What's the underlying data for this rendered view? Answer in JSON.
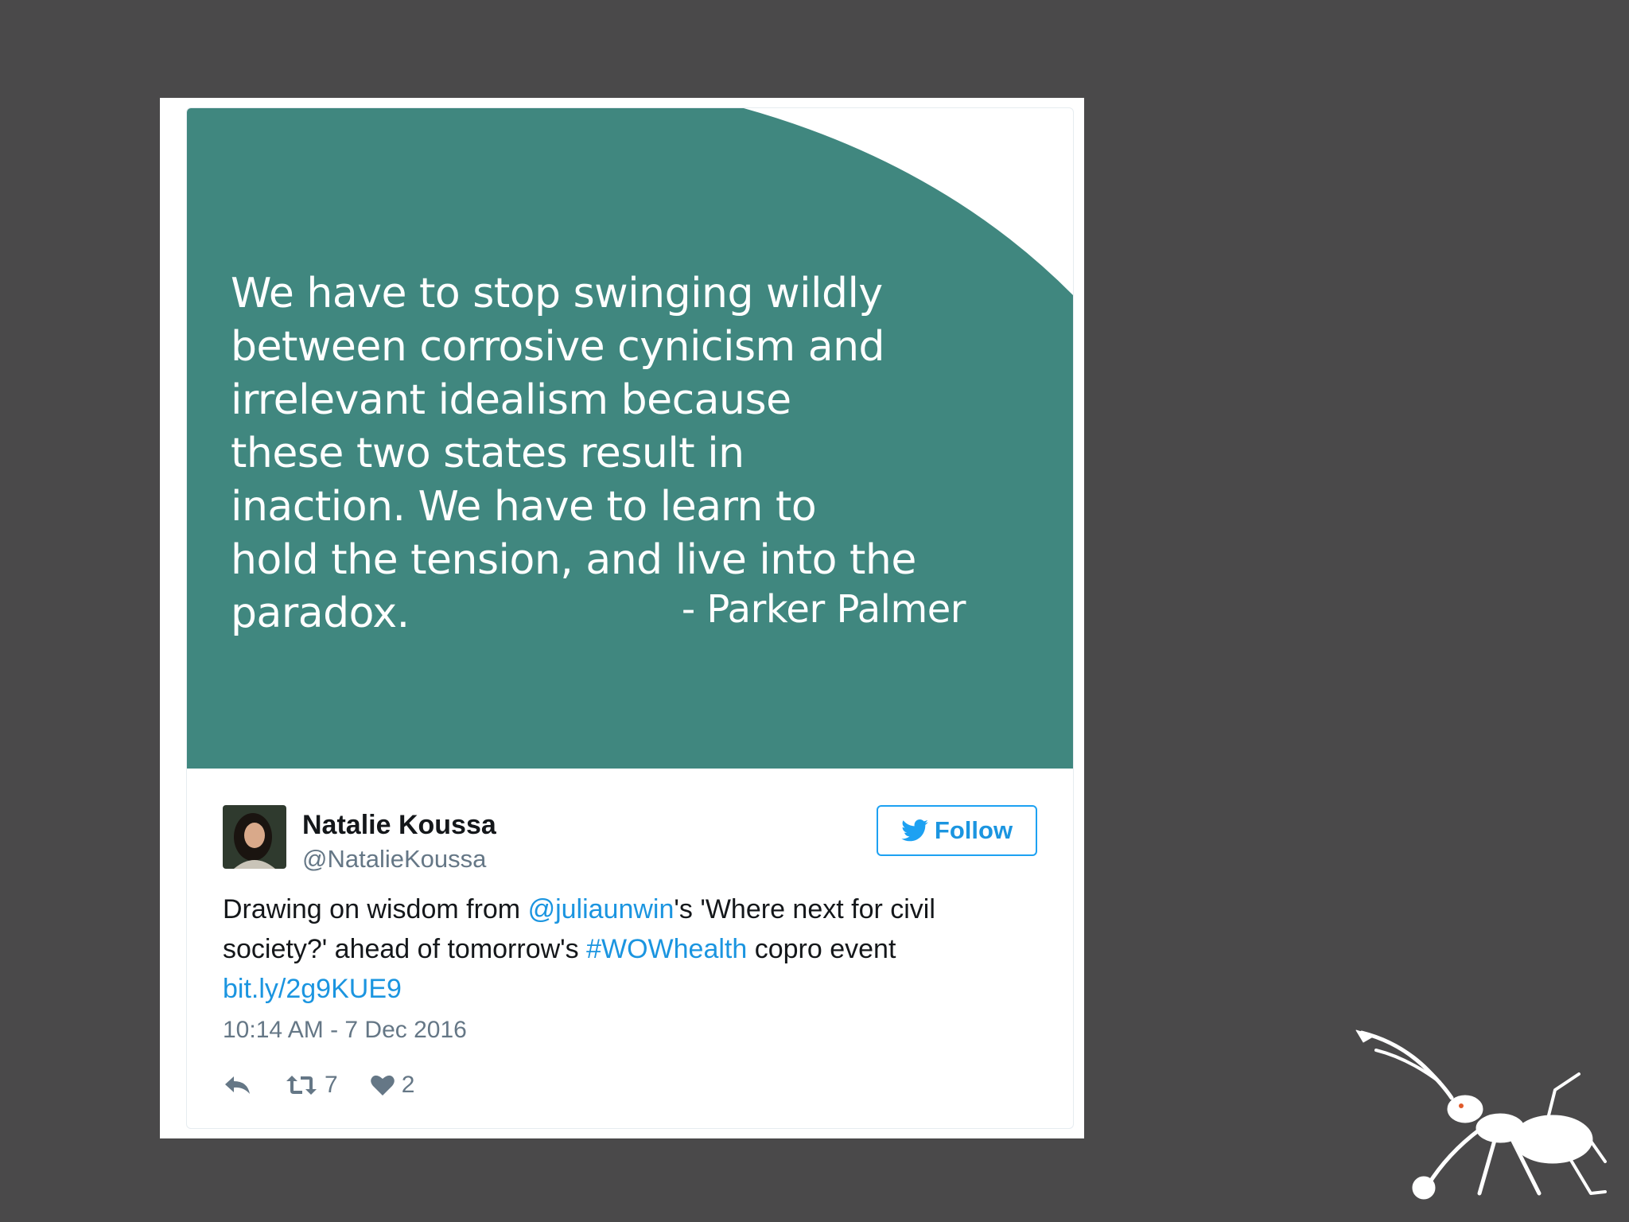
{
  "quote_card": {
    "text": "We have to stop swinging wildly\nbetween corrosive cynicism and\nirrelevant idealism because\nthese two states result in\ninaction. We have to learn to\nhold the tension, and live into the\nparadox.",
    "author": "- Parker Palmer",
    "background_color": "#40877f"
  },
  "tweet": {
    "user": {
      "name": "Natalie Koussa",
      "handle": "@NatalieKoussa"
    },
    "follow_label": "Follow",
    "body": {
      "part1": "Drawing on wisdom from ",
      "mention": "@juliaunwin",
      "part2": "'s 'Where next for civil society?' ahead of tomorrow's ",
      "hashtag": "#WOWhealth",
      "part3": " copro event ",
      "link": "bit.ly/2g9KUE9"
    },
    "timestamp": "10:14 AM - 7 Dec 2016",
    "actions": {
      "retweet_count": "7",
      "like_count": "2"
    },
    "link_color": "#1b95e0"
  },
  "icons": [
    "twitter-bird-icon",
    "reply-icon",
    "retweet-icon",
    "heart-icon",
    "ant-logo-icon"
  ]
}
